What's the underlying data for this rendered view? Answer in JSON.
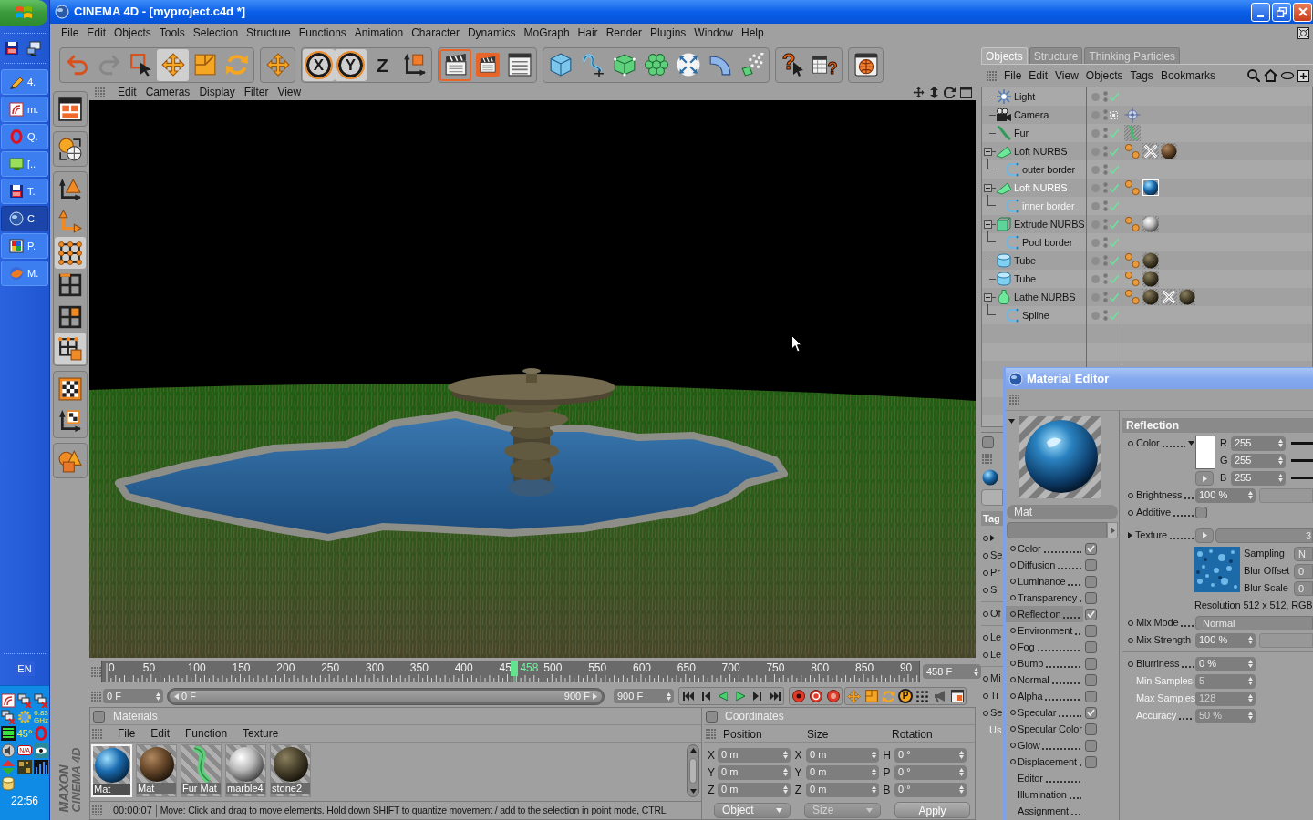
{
  "taskbar": {
    "items": [
      {
        "label": "4.",
        "selected": false
      },
      {
        "label": "m.",
        "selected": false
      },
      {
        "label": "Q.",
        "selected": false
      },
      {
        "label": "[..",
        "selected": false
      },
      {
        "label": "T.",
        "selected": false
      },
      {
        "label": "C.",
        "selected": true
      },
      {
        "label": "P.",
        "selected": false
      },
      {
        "label": "M.",
        "selected": false
      }
    ],
    "language": "EN",
    "tray": {
      "cpu_speed": "0.83",
      "cpu_unit": "GHz",
      "temperature": "45°",
      "badge": "N/A"
    },
    "clock": "22:56"
  },
  "window": {
    "title": "CINEMA 4D - [myproject.c4d *]"
  },
  "menu": [
    "File",
    "Edit",
    "Objects",
    "Tools",
    "Selection",
    "Structure",
    "Functions",
    "Animation",
    "Character",
    "Dynamics",
    "MoGraph",
    "Hair",
    "Render",
    "Plugins",
    "Window",
    "Help"
  ],
  "toolbar": [
    [
      {
        "kind": "undo",
        "selected": false,
        "disabled": false
      },
      {
        "kind": "redo",
        "selected": false,
        "disabled": true
      },
      {
        "kind": "select",
        "selected": false,
        "disabled": false
      },
      {
        "kind": "move",
        "selected": true,
        "disabled": false
      },
      {
        "kind": "scale",
        "selected": false,
        "disabled": false
      },
      {
        "kind": "rotate",
        "selected": false,
        "disabled": false
      }
    ],
    [
      {
        "kind": "world",
        "selected": false,
        "disabled": false
      }
    ],
    [
      {
        "kind": "axis",
        "label": "X",
        "selected": true,
        "disabled": false
      },
      {
        "kind": "axis",
        "label": "Y",
        "selected": true,
        "disabled": false
      },
      {
        "kind": "axis",
        "label": "Z",
        "selected": false,
        "disabled": false
      },
      {
        "kind": "coords",
        "selected": false,
        "disabled": false
      }
    ],
    [
      {
        "kind": "render_view",
        "selected": true,
        "disabled": false
      },
      {
        "kind": "render_picture",
        "selected": false,
        "disabled": false
      },
      {
        "kind": "render_settings",
        "selected": false,
        "disabled": false
      }
    ],
    [
      {
        "kind": "cube",
        "selected": false,
        "disabled": false
      },
      {
        "kind": "spline",
        "selected": false,
        "disabled": false
      },
      {
        "kind": "nurbs",
        "selected": false,
        "disabled": false
      },
      {
        "kind": "array",
        "selected": false,
        "disabled": false
      },
      {
        "kind": "scene",
        "selected": false,
        "disabled": false
      },
      {
        "kind": "deformer",
        "selected": false,
        "disabled": false
      },
      {
        "kind": "particles",
        "selected": false,
        "disabled": false
      }
    ],
    [
      {
        "kind": "help",
        "label": "?",
        "selected": false,
        "disabled": false
      },
      {
        "kind": "help_table",
        "label": "?",
        "selected": false,
        "disabled": false
      }
    ],
    [
      {
        "kind": "browser",
        "selected": false,
        "disabled": false
      }
    ]
  ],
  "side_toolbar": [
    [
      {
        "kind": "layout",
        "selected": false
      }
    ],
    [
      {
        "kind": "model",
        "selected": false
      }
    ],
    [
      {
        "kind": "axis_tri",
        "selected": false
      },
      {
        "kind": "axis",
        "selected": false
      },
      {
        "kind": "points",
        "selected": true
      },
      {
        "kind": "edges",
        "selected": false
      },
      {
        "kind": "polygons",
        "selected": false
      },
      {
        "kind": "object_mode",
        "selected": true
      }
    ],
    [
      {
        "kind": "texture",
        "selected": false
      },
      {
        "kind": "texture_axis",
        "selected": false
      }
    ],
    [
      {
        "kind": "primitives",
        "selected": false
      }
    ]
  ],
  "logo": [
    "MAXON",
    "CINEMA 4D"
  ],
  "viewport": {
    "menu": [
      "Edit",
      "Cameras",
      "Display",
      "Filter",
      "View"
    ]
  },
  "timeline": {
    "ticks": [
      "0",
      "50",
      "100",
      "150",
      "200",
      "250",
      "300",
      "350",
      "400",
      "45",
      "500",
      "550",
      "600",
      "650",
      "700",
      "750",
      "800",
      "850",
      "90"
    ],
    "current": "458",
    "level": 0.509,
    "frame": "458 F"
  },
  "range": {
    "start": "0 F",
    "slider_start": "0 F",
    "slider_end": "900 F",
    "level": 1,
    "end": "900 F",
    "key_label": "P"
  },
  "materials": {
    "title": "Materials",
    "checked": false,
    "menu": [
      "File",
      "Edit",
      "Function",
      "Texture"
    ],
    "items": [
      {
        "name": "Mat",
        "kind": "water",
        "selected": true
      },
      {
        "name": "Mat",
        "kind": "rock",
        "selected": false
      },
      {
        "name": "Fur Mat",
        "kind": "fur",
        "selected": false
      },
      {
        "name": "marble4",
        "kind": "marble",
        "selected": false
      },
      {
        "name": "stone2",
        "kind": "stone",
        "selected": false
      }
    ]
  },
  "status_bar": {
    "time": "00:00:07",
    "message": "Move: Click and drag to move elements. Hold down SHIFT to quantize movement / add to the selection in point mode, CTRL"
  },
  "coordinates": {
    "title": "Coordinates",
    "checked": false,
    "columns": [
      "Position",
      "Size",
      "Rotation"
    ],
    "rows": [
      [
        {
          "label": "X",
          "value": "0 m"
        },
        {
          "label": "X",
          "value": "0 m"
        },
        {
          "label": "H",
          "value": "0 °"
        }
      ],
      [
        {
          "label": "Y",
          "value": "0 m"
        },
        {
          "label": "Y",
          "value": "0 m"
        },
        {
          "label": "P",
          "value": "0 °"
        }
      ],
      [
        {
          "label": "Z",
          "value": "0 m"
        },
        {
          "label": "Z",
          "value": "0 m"
        },
        {
          "label": "B",
          "value": "0 °"
        }
      ]
    ],
    "buttons": [
      {
        "label": "Object",
        "kind": "dropdown",
        "disabled": false
      },
      {
        "label": "Size",
        "kind": "dropdown",
        "disabled": true
      },
      {
        "label": "Apply",
        "kind": "button",
        "disabled": false
      }
    ]
  },
  "object_manager": {
    "tabs": [
      {
        "label": "Objects",
        "selected": true
      },
      {
        "label": "Structure",
        "selected": false
      },
      {
        "label": "Thinking Particles",
        "selected": false
      }
    ],
    "menu": [
      "File",
      "Edit",
      "View",
      "Objects",
      "Tags",
      "Bookmarks"
    ],
    "objects": [
      {
        "name": "Light",
        "kind": "light",
        "selected": false,
        "dimmed": false,
        "enabled": true
      },
      {
        "name": "Camera",
        "kind": "camera",
        "selected": false,
        "dimmed": false,
        "enabled": true,
        "tags": [
          {
            "kind": "target",
            "selected": false
          }
        ]
      },
      {
        "name": "Fur",
        "kind": "fur",
        "selected": false,
        "dimmed": false,
        "enabled": true,
        "tags": [
          {
            "kind": "fur",
            "selected": false
          }
        ]
      },
      {
        "name": "Loft NURBS",
        "kind": "loft",
        "selected": false,
        "dimmed": false,
        "enabled": true,
        "expanded": true,
        "tags": [
          {
            "kind": "phong",
            "selected": false
          },
          {
            "kind": "cross",
            "selected": false
          },
          {
            "kind": "rock",
            "selected": false
          }
        ],
        "children": [
          {
            "name": "outer border",
            "kind": "spline",
            "selected": false,
            "dimmed": false,
            "enabled": true
          }
        ]
      },
      {
        "name": "Loft NURBS",
        "kind": "loft",
        "selected": true,
        "dimmed": false,
        "enabled": true,
        "expanded": true,
        "tags": [
          {
            "kind": "phong",
            "selected": false
          },
          {
            "kind": "water",
            "selected": true
          }
        ],
        "children": [
          {
            "name": "inner border",
            "kind": "spline",
            "selected": false,
            "dimmed": true,
            "enabled": true
          }
        ]
      },
      {
        "name": "Extrude NURBS",
        "kind": "extrude",
        "selected": false,
        "dimmed": false,
        "enabled": true,
        "expanded": true,
        "tags": [
          {
            "kind": "phong",
            "selected": false
          },
          {
            "kind": "marble",
            "selected": false
          }
        ],
        "children": [
          {
            "name": "Pool border",
            "kind": "spline",
            "selected": false,
            "dimmed": false,
            "enabled": true
          }
        ]
      },
      {
        "name": "Tube",
        "kind": "tube",
        "selected": false,
        "dimmed": false,
        "enabled": true,
        "tags": [
          {
            "kind": "phong",
            "selected": false
          },
          {
            "kind": "stone",
            "selected": false
          }
        ]
      },
      {
        "name": "Tube",
        "kind": "tube",
        "selected": false,
        "dimmed": false,
        "enabled": true,
        "tags": [
          {
            "kind": "phong",
            "selected": false
          },
          {
            "kind": "stone",
            "selected": false
          }
        ]
      },
      {
        "name": "Lathe NURBS",
        "kind": "lathe",
        "selected": false,
        "dimmed": false,
        "enabled": true,
        "expanded": true,
        "tags": [
          {
            "kind": "phong",
            "selected": false
          },
          {
            "kind": "stone",
            "selected": false
          },
          {
            "kind": "cross",
            "selected": false
          },
          {
            "kind": "stone",
            "selected": false
          }
        ],
        "children": [
          {
            "name": "Spline",
            "kind": "spline",
            "selected": false,
            "dimmed": false,
            "enabled": true
          }
        ]
      }
    ]
  },
  "attribute_manager": {
    "checked": false,
    "header": "Tag",
    "groups": [
      [
        {
          "kind": "group"
        },
        {
          "kind": "param",
          "label": "Se"
        },
        {
          "kind": "param",
          "label": "Pr"
        },
        {
          "kind": "param",
          "label": "Si"
        }
      ],
      [
        {
          "kind": "param",
          "label": "Of"
        }
      ],
      [
        {
          "kind": "param",
          "label": "Le"
        },
        {
          "kind": "param",
          "label": "Le"
        }
      ],
      [
        {
          "kind": "param",
          "label": "Mi"
        },
        {
          "kind": "param",
          "label": "Ti"
        },
        {
          "kind": "param",
          "label": "Se"
        },
        {
          "kind": "plain",
          "label": "Us"
        }
      ]
    ]
  },
  "material_editor": {
    "title": "Material Editor",
    "material_name": "Mat",
    "channels": [
      {
        "label": "Color",
        "kind": "channel",
        "checked": true,
        "selected": false
      },
      {
        "label": "Diffusion",
        "kind": "channel",
        "checked": false,
        "selected": false
      },
      {
        "label": "Luminance",
        "kind": "channel",
        "checked": false,
        "selected": false
      },
      {
        "label": "Transparency",
        "kind": "channel",
        "checked": false,
        "selected": false
      },
      {
        "label": "Reflection",
        "kind": "channel",
        "checked": true,
        "selected": true
      },
      {
        "label": "Environment",
        "kind": "channel",
        "checked": false,
        "selected": false
      },
      {
        "label": "Fog",
        "kind": "channel",
        "checked": false,
        "selected": false
      },
      {
        "label": "Bump",
        "kind": "channel",
        "checked": false,
        "selected": false
      },
      {
        "label": "Normal",
        "kind": "channel",
        "checked": false,
        "selected": false
      },
      {
        "label": "Alpha",
        "kind": "channel",
        "checked": false,
        "selected": false
      },
      {
        "label": "Specular",
        "kind": "channel",
        "checked": true,
        "selected": false
      },
      {
        "label": "Specular Color",
        "kind": "channel",
        "checked": false,
        "selected": false
      },
      {
        "label": "Glow",
        "kind": "channel",
        "checked": false,
        "selected": false
      },
      {
        "label": "Displacement",
        "kind": "channel",
        "checked": false,
        "selected": false
      },
      {
        "label": "Editor",
        "kind": "page",
        "selected": false
      },
      {
        "label": "Illumination",
        "kind": "page",
        "selected": false
      },
      {
        "label": "Assignment",
        "kind": "page",
        "selected": false
      }
    ],
    "section": "Reflection",
    "params": [
      {
        "kind": "color",
        "label": "Color",
        "color": "#ffffff",
        "channels": [
          {
            "label": "R",
            "value": "255"
          },
          {
            "label": "G",
            "value": "255"
          },
          {
            "label": "B",
            "value": "255"
          }
        ]
      },
      {
        "kind": "slider",
        "label": "Brightness",
        "value": "100 %",
        "disabled": false
      },
      {
        "kind": "checkbox",
        "label": "Additive",
        "checked": false
      },
      {
        "kind": "texture",
        "label": "Texture",
        "value": "3",
        "options": [
          {
            "label": "Sampling",
            "value": "N"
          },
          {
            "label": "Blur Offset",
            "value": "0"
          },
          {
            "label": "Blur Scale",
            "value": "0"
          }
        ],
        "info": "Resolution 512 x 512, RGB"
      },
      {
        "kind": "dropdown",
        "label": "Mix Mode",
        "value": "Normal"
      },
      {
        "kind": "slider",
        "label": "Mix Strength",
        "value": "100 %",
        "disabled": false
      },
      {
        "kind": "separator"
      },
      {
        "kind": "number",
        "label": "Blurriness",
        "value": "0 %",
        "disabled": false
      },
      {
        "kind": "number",
        "label": "Min Samples",
        "value": "5",
        "disabled": true
      },
      {
        "kind": "number",
        "label": "Max Samples",
        "value": "128",
        "disabled": true
      },
      {
        "kind": "number",
        "label": "Accuracy",
        "value": "50 %",
        "disabled": true
      }
    ]
  }
}
